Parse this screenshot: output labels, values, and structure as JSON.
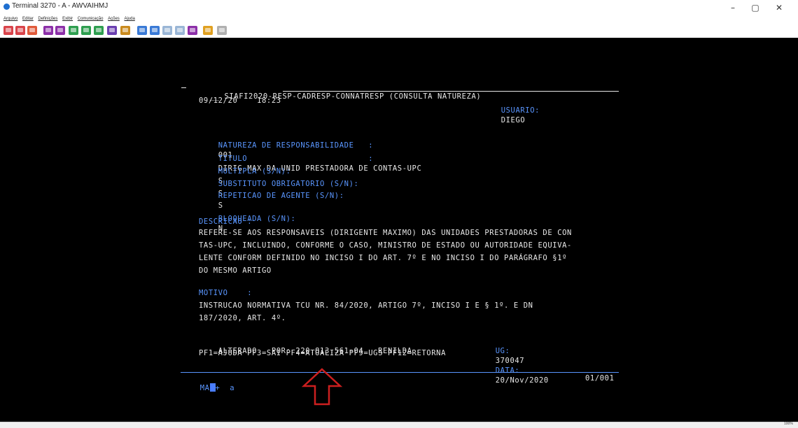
{
  "window": {
    "title": "Terminal 3270 - A - AWVAIHMJ",
    "minimize": "–",
    "maximize": "▢",
    "close": "✕"
  },
  "menu": [
    "Arquivo",
    "Editar",
    "Definições",
    "Exibir",
    "Comunicação",
    "Ações",
    "Ajuda"
  ],
  "toolbar_icons": [
    {
      "name": "connect-icon",
      "color": "#d9434a"
    },
    {
      "name": "disconnect-icon",
      "color": "#d9434a"
    },
    {
      "name": "exit-icon",
      "color": "#e05a3a"
    },
    {
      "name": "send-icon",
      "color": "#8c2fa8"
    },
    {
      "name": "receive-icon",
      "color": "#8c2fa8"
    },
    {
      "name": "copy-icon",
      "color": "#2e9e4f"
    },
    {
      "name": "paste-icon",
      "color": "#2e9e4f"
    },
    {
      "name": "transfer-icon",
      "color": "#2e9e4f"
    },
    {
      "name": "keyboard-icon",
      "color": "#6a3fb0"
    },
    {
      "name": "macro-icon",
      "color": "#c98a1e"
    },
    {
      "name": "record-icon",
      "color": "#3a7ad6"
    },
    {
      "name": "play-icon",
      "color": "#3a7ad6"
    },
    {
      "name": "stop-icon",
      "color": "#9ab6d6"
    },
    {
      "name": "pause-icon",
      "color": "#9ab6d6"
    },
    {
      "name": "link-icon",
      "color": "#8c2fa8"
    },
    {
      "name": "download-icon",
      "color": "#e0a020"
    },
    {
      "name": "refresh-icon",
      "color": "#b0b0b0"
    }
  ],
  "screen": {
    "header_line": "SIAFI2020-RESP-CADRESP-CONNATRESP (CONSULTA NATUREZA)",
    "date_time": "09/12/20    18:23",
    "usuario_label": "USUARIO:",
    "usuario_value": "DIEGO",
    "natureza_label": "NATUREZA DE RESPONSABILIDADE   :",
    "natureza_value": "001",
    "titulo_label": "TITULO                         :",
    "titulo_value": "DIRIG MAX DA UNID PRESTADORA DE CONTAS-UPC",
    "multipla_label": "MULTIPLA (S/N):",
    "multipla_value": "S",
    "substituto_label": "SUBSTITUTO OBRIGATORIO (S/N):",
    "substituto_value": "S",
    "repeticao_label": "REPETICAO DE AGENTE (S/N):",
    "repeticao_value": "S",
    "bloqueada_label": "BLOQUEADA (S/N):",
    "bloqueada_value": "N",
    "descricao_label": "DESCRICAO :",
    "descricao_lines": [
      "REFERE-SE AOS RESPONSAVEIS (DIRIGENTE MAXIMO) DAS UNIDADES PRESTADORAS DE CON",
      "TAS-UPC, INCLUINDO, CONFORME O CASO, MINISTRO DE ESTADO OU AUTORIDADE EQUIVA-",
      "LENTE CONFORM DEFINIDO NO INCISO I DO ART. 7º E NO INCISO I DO PARÁGRAFO §1º",
      "DO MESMO ARTIGO"
    ],
    "motivo_label": "MOTIVO    :",
    "motivo_lines": [
      "INSTRUCAO NORMATIVA TCU NR. 84/2020, ARTIGO 7º, INCISO I E § 1º. E DN",
      "187/2020, ART. 4º."
    ],
    "alterado_text": "ALTERADO   POR: 220.813.561-04   RENILDA",
    "ug_label": "UG:",
    "ug_value": "370047",
    "data_label": "DATA:",
    "data_value": "20/Nov/2020",
    "pf_keys": "PF1=AJUDA PF3=SAI PF4=ATUALIZA PF9=UGS PF12=RETORNA",
    "status_left_prefix": "MA",
    "status_left_suffix": "+  a",
    "page_counter": "01/001"
  },
  "colors": {
    "field_label": "#5a96ff",
    "field_value": "#e8e8e8",
    "arrow": "#cc1f1f"
  },
  "statusbar": {
    "zoom": "100%"
  }
}
